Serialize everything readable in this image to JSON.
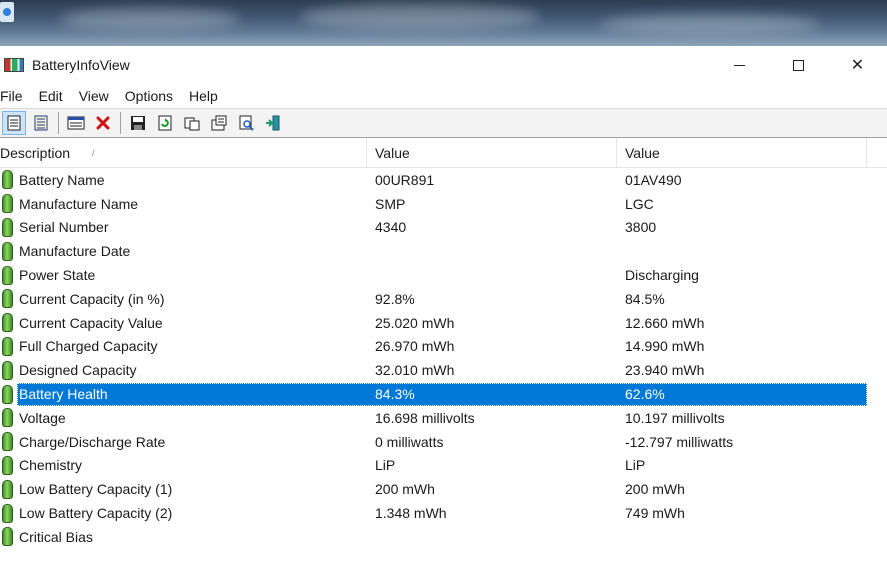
{
  "window": {
    "title": "BatteryInfoView",
    "controls": {
      "close": "✕"
    }
  },
  "menu": [
    "File",
    "Edit",
    "View",
    "Options",
    "Help"
  ],
  "toolbar": {
    "icons": [
      "html-report-icon",
      "properties-icon",
      "options-icon",
      "delete-icon",
      "save-icon",
      "refresh-icon",
      "copy-icon",
      "properties-sheet-icon",
      "find-icon",
      "exit-icon"
    ]
  },
  "table": {
    "headers": [
      "Description",
      "Value",
      "Value"
    ],
    "sort_indicator": "/",
    "rows": [
      {
        "label": "Battery Name",
        "v1": "00UR891",
        "v2": "01AV490"
      },
      {
        "label": "Manufacture Name",
        "v1": "SMP",
        "v2": "LGC"
      },
      {
        "label": "Serial Number",
        "v1": " 4340",
        "v2": " 3800"
      },
      {
        "label": "Manufacture Date",
        "v1": "",
        "v2": ""
      },
      {
        "label": "Power State",
        "v1": "",
        "v2": "Discharging"
      },
      {
        "label": "Current Capacity (in %)",
        "v1": "92.8%",
        "v2": "84.5%"
      },
      {
        "label": "Current Capacity Value",
        "v1": "25.020 mWh",
        "v2": "12.660 mWh"
      },
      {
        "label": "Full Charged Capacity",
        "v1": "26.970 mWh",
        "v2": "14.990 mWh"
      },
      {
        "label": "Designed Capacity",
        "v1": "32.010 mWh",
        "v2": "23.940 mWh"
      },
      {
        "label": "Battery Health",
        "v1": "84.3%",
        "v2": "62.6%",
        "selected": true
      },
      {
        "label": "Voltage",
        "v1": "16.698 millivolts",
        "v2": "10.197 millivolts"
      },
      {
        "label": "Charge/Discharge Rate",
        "v1": "0 milliwatts",
        "v2": "-12.797 milliwatts"
      },
      {
        "label": "Chemistry",
        "v1": "LiP",
        "v2": "LiP"
      },
      {
        "label": "Low Battery Capacity (1)",
        "v1": "200 mWh",
        "v2": "200 mWh"
      },
      {
        "label": "Low Battery Capacity (2)",
        "v1": "1.348 mWh",
        "v2": "749 mWh"
      },
      {
        "label": "Critical Bias",
        "v1": "",
        "v2": ""
      }
    ]
  },
  "colors": {
    "selection": "#0078d7",
    "battery_icon": "#5cb83a"
  }
}
